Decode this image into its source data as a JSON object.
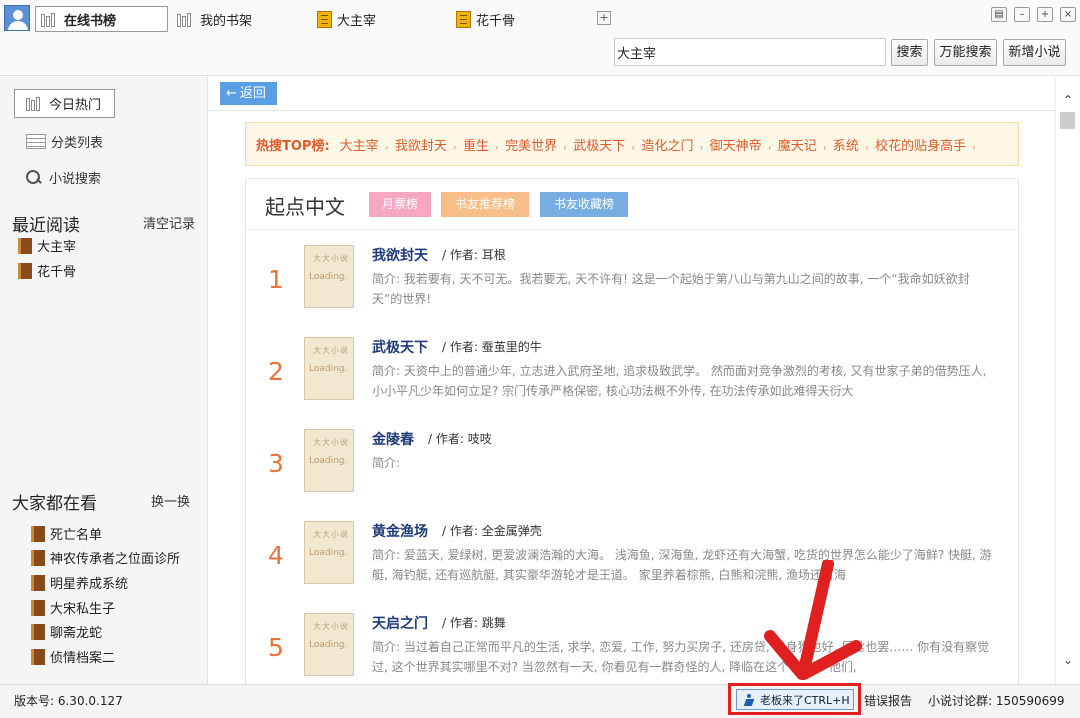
{
  "tabs": {
    "online": "在线书榜",
    "shelf": "我的书架",
    "book1": "大主宰",
    "book2": "花千骨"
  },
  "search": {
    "value": "大主宰",
    "search_label": "搜索",
    "universal_label": "万能搜索",
    "add_label": "新增小说"
  },
  "sidebar": {
    "hot_today": "今日热门",
    "category_list": "分类列表",
    "novel_search": "小说搜索",
    "recent_title": "最近阅读",
    "clear_label": "清空记录",
    "recent_items": [
      "大主宰",
      "花千骨"
    ],
    "watching_title": "大家都在看",
    "refresh_label": "换一换",
    "watching_items": [
      "死亡名单",
      "神农传承者之位面诊所",
      "明星养成系统",
      "大宋私生子",
      "聊斋龙蛇",
      "侦情档案二"
    ]
  },
  "main": {
    "back_label": "返回",
    "hot_label": "热搜TOP榜:",
    "hot_keywords": [
      "大主宰",
      "我欲封天",
      "重生",
      "完美世界",
      "武极天下",
      "造化之门",
      "御天神帝",
      "魔天记",
      "系统",
      "校花的贴身高手"
    ],
    "panel_title": "起点中文",
    "rank_tabs": [
      "月票榜",
      "书友推荐榜",
      "书友收藏榜"
    ],
    "books": [
      {
        "rank": "1",
        "title": "我欲封天",
        "author": "/ 作者: 耳根",
        "intro": "简介: 我若要有, 天不可无。我若要无, 天不许有! 这是一个起始于第八山与第九山之间的故事, 一个“我命如妖欲封天”的世界!"
      },
      {
        "rank": "2",
        "title": "武极天下",
        "author": "/ 作者: 蚕茧里的牛",
        "intro": "简介:    天资中上的普通少年, 立志进入武府圣地, 追求极致武学。 然而面对竞争激烈的考核, 又有世家子弟的借势压人, 小小平凡少年如何立足? 宗门传承严格保密, 核心功法概不外传, 在功法传承如此难得天衍大"
      },
      {
        "rank": "3",
        "title": "金陵春",
        "author": "/ 作者: 吱吱",
        "intro": "简介:"
      },
      {
        "rank": "4",
        "title": "黄金渔场",
        "author": "/ 作者: 全金属弹壳",
        "intro": "简介: 爱蓝天, 爱绿树, 更爱波澜浩瀚的大海。 浅海鱼, 深海鱼, 龙虾还有大海蟹, 吃货的世界怎么能少了海鲜? 快艇, 游艇, 海钓艇, 还有巡航艇, 其实豪华游轮才是王道。 家里养着棕熊, 白熊和浣熊, 渔场还有海"
      },
      {
        "rank": "5",
        "title": "天启之门",
        "author": "/ 作者: 跳舞",
        "intro": "简介: 当过着自己正常而平凡的生活, 求学, 恋爱, 工作, 努力买房子, 还房贷, 单身狗也好, 屌丝也罢…… 你有没有察觉过, 这个世界其实哪里不对? 当忽然有一天, 你看见有一群奇怪的人, 降临在这个世界。 他们,"
      }
    ],
    "cover_deco": "大大小说",
    "cover_loading": "Loading."
  },
  "status": {
    "version": "版本号: 6.30.0.127",
    "boss_label": "老板来了CTRL+H",
    "error_report": "错误报告",
    "qq_group": "小说讨论群: 150590699"
  },
  "colors": {
    "accent_blue": "#5a9ee4",
    "hot_orange": "#e05b2b",
    "rank_tab_pink": "#f6a7c2",
    "rank_tab_orange": "#f8be89",
    "rank_tab_blue": "#78aee4",
    "annotation_red": "#e02020"
  },
  "icons": {
    "avatar": "user-avatar-icon",
    "shelf": "bookshelf-icon",
    "book": "book-icon",
    "list": "list-icon",
    "search": "search-icon",
    "back": "arrow-left-icon",
    "boss": "running-man-icon"
  }
}
